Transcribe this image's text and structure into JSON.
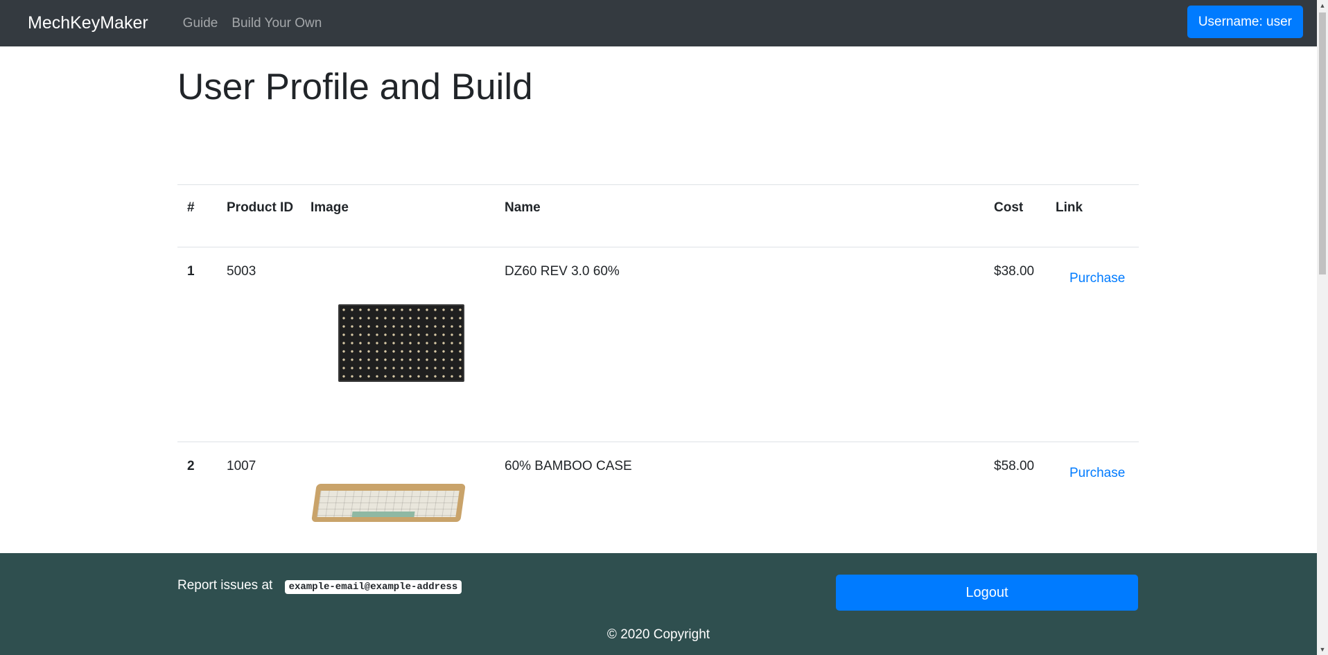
{
  "navbar": {
    "brand": "MechKeyMaker",
    "links": [
      "Guide",
      "Build Your Own"
    ],
    "user_button": "Username: user"
  },
  "page": {
    "title": "User Profile and Build"
  },
  "table": {
    "headers": [
      "#",
      "Product ID",
      "Image",
      "Name",
      "Cost",
      "Link"
    ],
    "rows": [
      {
        "index": "1",
        "product_id": "5003",
        "name": "DZ60 REV 3.0 60%",
        "cost": "$38.00",
        "link": "Purchase"
      },
      {
        "index": "2",
        "product_id": "1007",
        "name": "60% BAMBOO CASE",
        "cost": "$58.00",
        "link": "Purchase"
      }
    ]
  },
  "footer": {
    "report_text": "Report issues at",
    "email": "example-email@example-address",
    "logout": "Logout",
    "copyright": "© 2020 Copyright"
  }
}
